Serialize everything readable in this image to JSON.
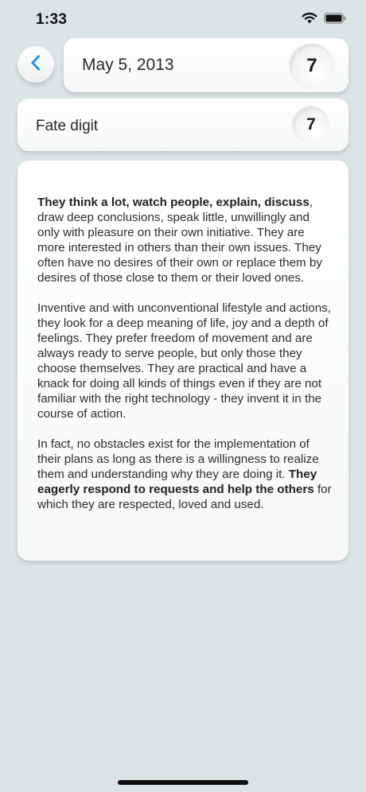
{
  "status_bar": {
    "time": "1:33",
    "icons": [
      "wifi-icon",
      "battery-icon"
    ]
  },
  "header": {
    "back_icon": "chevron-left-icon",
    "date": "May 5, 2013",
    "date_number": "7"
  },
  "fate": {
    "label": "Fate digit",
    "value": "7"
  },
  "description": {
    "p1_bold": "They think a lot, watch people, explain, discuss",
    "p1_rest": ", draw deep conclusions, speak little, unwillingly and only with pleasure on their own initiative. They are more interested in others than their own issues. They often have no desires of their own or replace them by desires of those close to them or their loved ones.",
    "p2": "Inventive and with unconventional lifestyle and actions, they look for a deep meaning of life, joy and a depth of feelings. They prefer freedom of movement and are always ready to serve people, but only those they choose themselves. They are practical and have a knack for doing all kinds of things even if they are not familiar with the right technology - they invent it in the course of action.",
    "p3_start": "In fact, no obstacles exist for the implementation of their plans as long as there is a willingness to realize them and understanding why they are doing it. ",
    "p3_bold": "They eagerly respond to requests and help the others",
    "p3_end": " for which they are respected, loved and used."
  },
  "colors": {
    "background": "#dce5e6",
    "accent": "#2b8fe0",
    "card": "#ffffff",
    "text": "#2a2a2a"
  }
}
